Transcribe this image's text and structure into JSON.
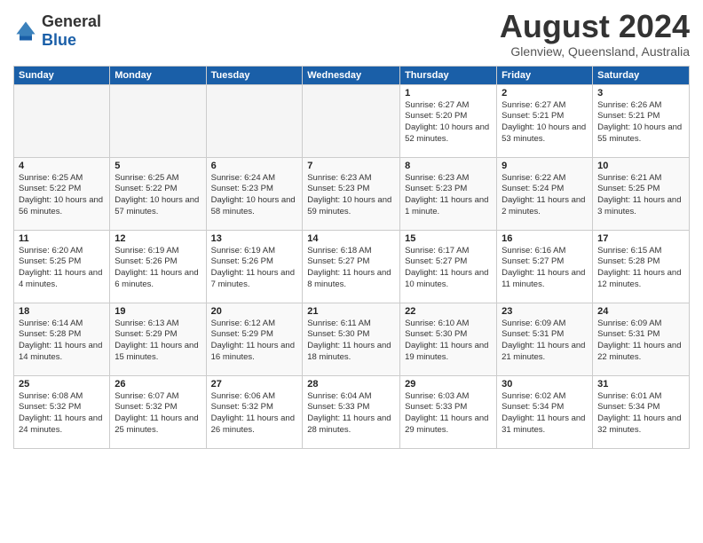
{
  "header": {
    "logo_general": "General",
    "logo_blue": "Blue",
    "month_title": "August 2024",
    "location": "Glenview, Queensland, Australia"
  },
  "weekdays": [
    "Sunday",
    "Monday",
    "Tuesday",
    "Wednesday",
    "Thursday",
    "Friday",
    "Saturday"
  ],
  "weeks": [
    [
      {
        "day": "",
        "empty": true
      },
      {
        "day": "",
        "empty": true
      },
      {
        "day": "",
        "empty": true
      },
      {
        "day": "",
        "empty": true
      },
      {
        "day": "1",
        "sunrise": "6:27 AM",
        "sunset": "5:20 PM",
        "daylight": "10 hours and 52 minutes."
      },
      {
        "day": "2",
        "sunrise": "6:27 AM",
        "sunset": "5:21 PM",
        "daylight": "10 hours and 53 minutes."
      },
      {
        "day": "3",
        "sunrise": "6:26 AM",
        "sunset": "5:21 PM",
        "daylight": "10 hours and 55 minutes."
      }
    ],
    [
      {
        "day": "4",
        "sunrise": "6:25 AM",
        "sunset": "5:22 PM",
        "daylight": "10 hours and 56 minutes."
      },
      {
        "day": "5",
        "sunrise": "6:25 AM",
        "sunset": "5:22 PM",
        "daylight": "10 hours and 57 minutes."
      },
      {
        "day": "6",
        "sunrise": "6:24 AM",
        "sunset": "5:23 PM",
        "daylight": "10 hours and 58 minutes."
      },
      {
        "day": "7",
        "sunrise": "6:23 AM",
        "sunset": "5:23 PM",
        "daylight": "10 hours and 59 minutes."
      },
      {
        "day": "8",
        "sunrise": "6:23 AM",
        "sunset": "5:23 PM",
        "daylight": "11 hours and 1 minute."
      },
      {
        "day": "9",
        "sunrise": "6:22 AM",
        "sunset": "5:24 PM",
        "daylight": "11 hours and 2 minutes."
      },
      {
        "day": "10",
        "sunrise": "6:21 AM",
        "sunset": "5:25 PM",
        "daylight": "11 hours and 3 minutes."
      }
    ],
    [
      {
        "day": "11",
        "sunrise": "6:20 AM",
        "sunset": "5:25 PM",
        "daylight": "11 hours and 4 minutes."
      },
      {
        "day": "12",
        "sunrise": "6:19 AM",
        "sunset": "5:26 PM",
        "daylight": "11 hours and 6 minutes."
      },
      {
        "day": "13",
        "sunrise": "6:19 AM",
        "sunset": "5:26 PM",
        "daylight": "11 hours and 7 minutes."
      },
      {
        "day": "14",
        "sunrise": "6:18 AM",
        "sunset": "5:27 PM",
        "daylight": "11 hours and 8 minutes."
      },
      {
        "day": "15",
        "sunrise": "6:17 AM",
        "sunset": "5:27 PM",
        "daylight": "11 hours and 10 minutes."
      },
      {
        "day": "16",
        "sunrise": "6:16 AM",
        "sunset": "5:27 PM",
        "daylight": "11 hours and 11 minutes."
      },
      {
        "day": "17",
        "sunrise": "6:15 AM",
        "sunset": "5:28 PM",
        "daylight": "11 hours and 12 minutes."
      }
    ],
    [
      {
        "day": "18",
        "sunrise": "6:14 AM",
        "sunset": "5:28 PM",
        "daylight": "11 hours and 14 minutes."
      },
      {
        "day": "19",
        "sunrise": "6:13 AM",
        "sunset": "5:29 PM",
        "daylight": "11 hours and 15 minutes."
      },
      {
        "day": "20",
        "sunrise": "6:12 AM",
        "sunset": "5:29 PM",
        "daylight": "11 hours and 16 minutes."
      },
      {
        "day": "21",
        "sunrise": "6:11 AM",
        "sunset": "5:30 PM",
        "daylight": "11 hours and 18 minutes."
      },
      {
        "day": "22",
        "sunrise": "6:10 AM",
        "sunset": "5:30 PM",
        "daylight": "11 hours and 19 minutes."
      },
      {
        "day": "23",
        "sunrise": "6:09 AM",
        "sunset": "5:31 PM",
        "daylight": "11 hours and 21 minutes."
      },
      {
        "day": "24",
        "sunrise": "6:09 AM",
        "sunset": "5:31 PM",
        "daylight": "11 hours and 22 minutes."
      }
    ],
    [
      {
        "day": "25",
        "sunrise": "6:08 AM",
        "sunset": "5:32 PM",
        "daylight": "11 hours and 24 minutes."
      },
      {
        "day": "26",
        "sunrise": "6:07 AM",
        "sunset": "5:32 PM",
        "daylight": "11 hours and 25 minutes."
      },
      {
        "day": "27",
        "sunrise": "6:06 AM",
        "sunset": "5:32 PM",
        "daylight": "11 hours and 26 minutes."
      },
      {
        "day": "28",
        "sunrise": "6:04 AM",
        "sunset": "5:33 PM",
        "daylight": "11 hours and 28 minutes."
      },
      {
        "day": "29",
        "sunrise": "6:03 AM",
        "sunset": "5:33 PM",
        "daylight": "11 hours and 29 minutes."
      },
      {
        "day": "30",
        "sunrise": "6:02 AM",
        "sunset": "5:34 PM",
        "daylight": "11 hours and 31 minutes."
      },
      {
        "day": "31",
        "sunrise": "6:01 AM",
        "sunset": "5:34 PM",
        "daylight": "11 hours and 32 minutes."
      }
    ]
  ],
  "labels": {
    "sunrise_prefix": "Sunrise: ",
    "sunset_prefix": "Sunset: ",
    "daylight_prefix": "Daylight: "
  }
}
